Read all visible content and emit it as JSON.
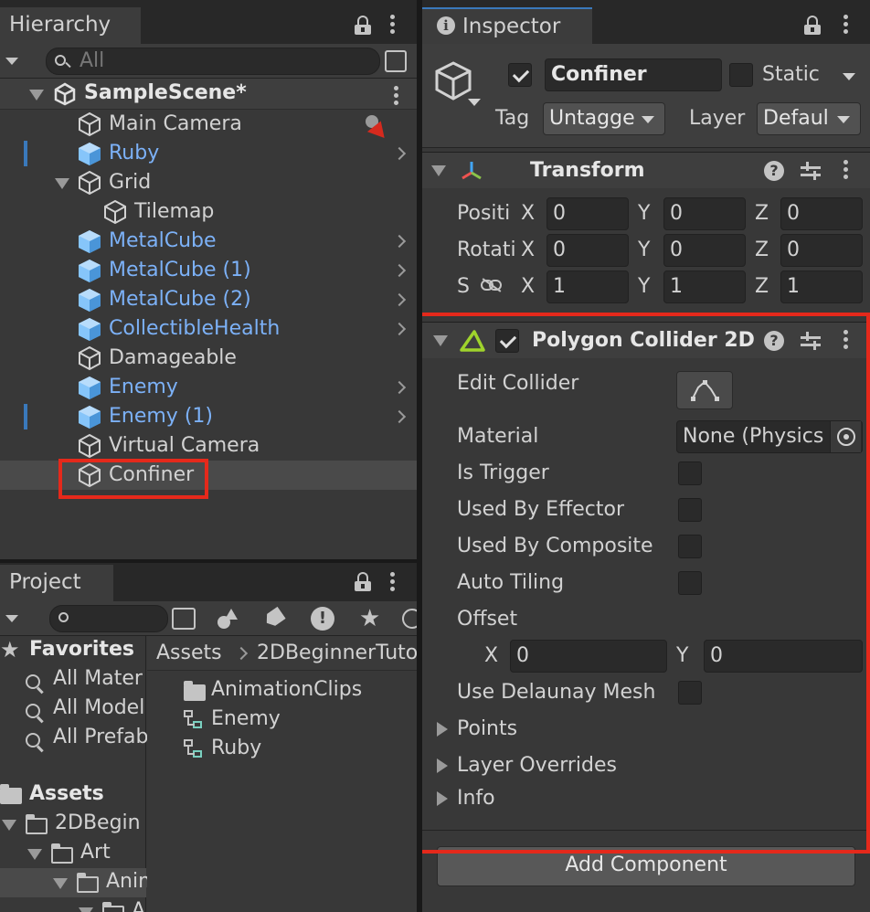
{
  "hierarchy": {
    "tab_label": "Hierarchy",
    "search_placeholder": "All",
    "scene_name": "SampleScene*",
    "items": [
      {
        "label": "Main Camera",
        "prefab": false
      },
      {
        "label": "Ruby",
        "prefab": true
      },
      {
        "label": "Grid",
        "prefab": false
      },
      {
        "label": "Tilemap",
        "prefab": false
      },
      {
        "label": "MetalCube",
        "prefab": true
      },
      {
        "label": "MetalCube (1)",
        "prefab": true
      },
      {
        "label": "MetalCube (2)",
        "prefab": true
      },
      {
        "label": "CollectibleHealth",
        "prefab": true
      },
      {
        "label": "Damageable",
        "prefab": false
      },
      {
        "label": "Enemy",
        "prefab": true
      },
      {
        "label": "Enemy (1)",
        "prefab": true
      },
      {
        "label": "Virtual Camera",
        "prefab": false
      },
      {
        "label": "Confiner",
        "prefab": false
      }
    ]
  },
  "project": {
    "tab_label": "Project",
    "sidebar": {
      "favorites_label": "Favorites",
      "favorites": [
        "All Mater",
        "All Model",
        "All Prefab"
      ],
      "assets_label": "Assets",
      "tree": [
        "2DBegin",
        "Art",
        "Anim",
        "A"
      ]
    },
    "breadcrumb": [
      "Assets",
      "2DBeginnerTuto"
    ],
    "files": [
      {
        "label": "AnimationClips",
        "kind": "folder"
      },
      {
        "label": "Enemy",
        "kind": "prefab"
      },
      {
        "label": "Ruby",
        "kind": "prefab"
      }
    ]
  },
  "inspector": {
    "tab_label": "Inspector",
    "object_name": "Confiner",
    "object_active": true,
    "static_label": "Static",
    "static_checked": false,
    "tag_label": "Tag",
    "tag_value": "Untagge",
    "layer_label": "Layer",
    "layer_value": "Defaul",
    "transform": {
      "title": "Transform",
      "rows": [
        {
          "label": "Positi",
          "x": "0",
          "y": "0",
          "z": "0"
        },
        {
          "label": "Rotati",
          "x": "0",
          "y": "0",
          "z": "0"
        },
        {
          "label": "S",
          "x": "1",
          "y": "1",
          "z": "1"
        }
      ],
      "axis_x": "X",
      "axis_y": "Y",
      "axis_z": "Z"
    },
    "collider": {
      "title": "Polygon Collider 2D",
      "enabled": true,
      "edit_collider_label": "Edit Collider",
      "material_label": "Material",
      "material_value": "None (Physics",
      "is_trigger_label": "Is Trigger",
      "used_by_effector_label": "Used By Effector",
      "used_by_composite_label": "Used By Composite",
      "auto_tiling_label": "Auto Tiling",
      "offset_label": "Offset",
      "offset_x_label": "X",
      "offset_x": "0",
      "offset_y_label": "Y",
      "offset_y": "0",
      "delaunay_label": "Use Delaunay Mesh",
      "points_label": "Points",
      "layer_overrides_label": "Layer Overrides",
      "info_label": "Info"
    },
    "add_component_label": "Add Component"
  },
  "colors": {
    "highlight": "#e5291b",
    "prefab_blue": "#7cb1f7",
    "panel_bg": "#383838"
  }
}
